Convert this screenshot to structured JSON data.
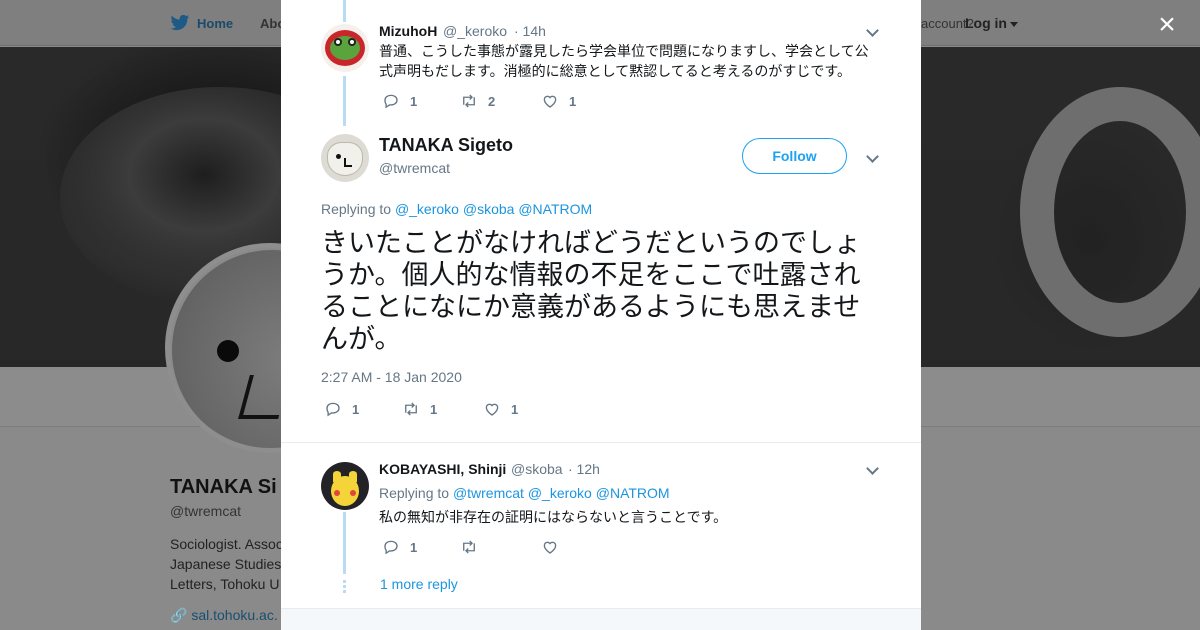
{
  "nav": {
    "home": "Home",
    "about": "Abo",
    "account": "account?",
    "login": "Log in"
  },
  "profile": {
    "name": "TANAKA Si",
    "handle": "@twremcat",
    "bio_lines": [
      "Sociologist. Assoc",
      "Japanese Studies",
      "Letters, Tohoku U"
    ],
    "link": "sal.tohoku.ac."
  },
  "close_icon": "×",
  "tweets": {
    "prev": {
      "name": "MizuhoH",
      "handle": "@_keroko",
      "time": "· 14h",
      "text": "普通、こうした事態が露見したら学会単位で問題になりますし、学会として公式声明もだします。消極的に総意として黙認してると考えるのがすじです。",
      "replies": "1",
      "retweets": "2",
      "likes": "1"
    },
    "main": {
      "name": "TANAKA Sigeto",
      "handle": "@twremcat",
      "follow": "Follow",
      "replying_to": "Replying to",
      "mentions": [
        "@_keroko",
        "@skoba",
        "@NATROM"
      ],
      "text": "きいたことがなければどうだというのでしょうか。個人的な情報の不足をここで吐露されることになにか意義があるようにも思えませんが。",
      "timestamp": "2:27 AM - 18 Jan 2020",
      "replies": "1",
      "retweets": "1",
      "likes": "1"
    },
    "reply": {
      "name": "KOBAYASHI, Shinji",
      "handle": "@skoba",
      "time": "· 12h",
      "replying_to": "Replying to",
      "mentions": [
        "@twremcat",
        "@_keroko",
        "@NATROM"
      ],
      "text": "私の無知が非存在の証明にはならないと言うことです。",
      "replies": "1",
      "retweets": "",
      "likes": ""
    },
    "more_reply": "1 more reply"
  },
  "colors": {
    "accent": "#1da1f2",
    "thread_line": "#b8dcf5",
    "muted": "#657786"
  }
}
